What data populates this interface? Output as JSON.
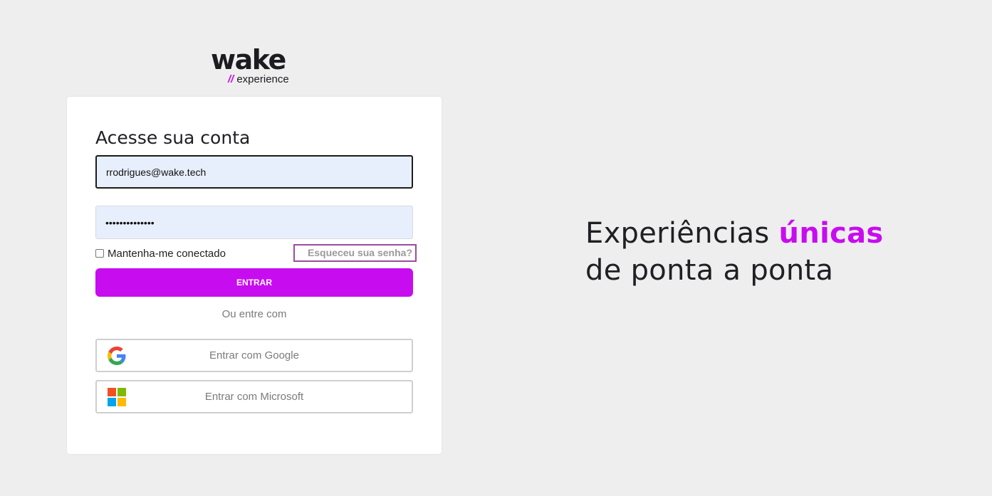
{
  "logo": {
    "word": "wake",
    "slashes": "//",
    "sub": "experience"
  },
  "login": {
    "title": "Acesse sua conta",
    "email_value": "rrodrigues@wake.tech",
    "password_value": "••••••••••••••",
    "remember_label": "Mantenha-me conectado",
    "remember_checked": false,
    "forgot_label": "Esqueceu sua senha?",
    "enter_label": "ENTRAR",
    "or_label": "Ou entre com",
    "google_label": "Entrar com Google",
    "microsoft_label": "Entrar com Microsoft"
  },
  "tagline": {
    "line1_prefix": "Experiências ",
    "line1_accent": "únicas",
    "line2": "de ponta a ponta"
  },
  "colors": {
    "accent": "#c80cf0",
    "background": "#eeeeee",
    "input_bg": "#e8effc"
  },
  "icons": {
    "google": "google-logo-icon",
    "microsoft": "microsoft-logo-icon"
  }
}
